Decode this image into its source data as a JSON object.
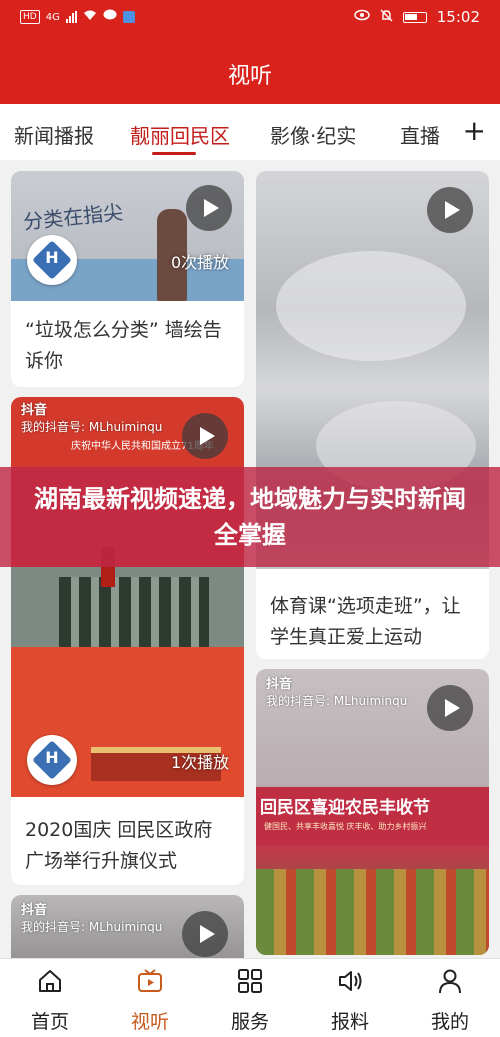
{
  "status_bar": {
    "carrier_badge": "HD",
    "speed": "4G",
    "time": "15:02"
  },
  "header": {
    "title": "视听"
  },
  "tabs": [
    {
      "label": "新闻播报",
      "active": false
    },
    {
      "label": "靓丽回民区",
      "active": true
    },
    {
      "label": "影像·纪实",
      "active": false
    },
    {
      "label": "直播",
      "active": false
    }
  ],
  "add_tab_label": "+",
  "cards": [
    {
      "caption": "“垃圾怎么分类” 墙绘告诉你",
      "views": "0次播放",
      "thumb_text": "分类在指尖"
    },
    {
      "caption": "体育课“选项走班”，让学生真正爱上运动",
      "views": ""
    },
    {
      "caption": "2020国庆 回民区政府广场举行升旗仪式",
      "views": "1次播放",
      "tiktok_brand": "抖音",
      "tiktok_id": "我的抖音号: MLhuiminqu",
      "thumb_text": "庆祝中华人民共和国成立71周年"
    },
    {
      "caption": "",
      "views": "",
      "tiktok_brand": "抖音",
      "tiktok_id": "我的抖音号: MLhuiminqu",
      "thumb_text": "回民区喜迎农民丰收节",
      "thumb_subtext": "健国民、共享丰收喜悦  庆丰收、助力乡村振兴"
    },
    {
      "caption": "",
      "views": "",
      "tiktok_brand": "抖音",
      "tiktok_id": "我的抖音号: MLhuiminqu"
    }
  ],
  "banner": {
    "text": "湖南最新视频速递，地域魅力与实时新闻全掌握"
  },
  "bottom_nav": [
    {
      "label": "首页",
      "icon": "home-icon",
      "active": false
    },
    {
      "label": "视听",
      "icon": "video-icon",
      "active": true
    },
    {
      "label": "服务",
      "icon": "grid-icon",
      "active": false
    },
    {
      "label": "报料",
      "icon": "speaker-icon",
      "active": false
    },
    {
      "label": "我的",
      "icon": "user-icon",
      "active": false
    }
  ],
  "colors": {
    "brand_red": "#d9221c",
    "active_tab": "#c41d1a",
    "active_nav": "#c75b1e",
    "banner": "#be2846"
  }
}
